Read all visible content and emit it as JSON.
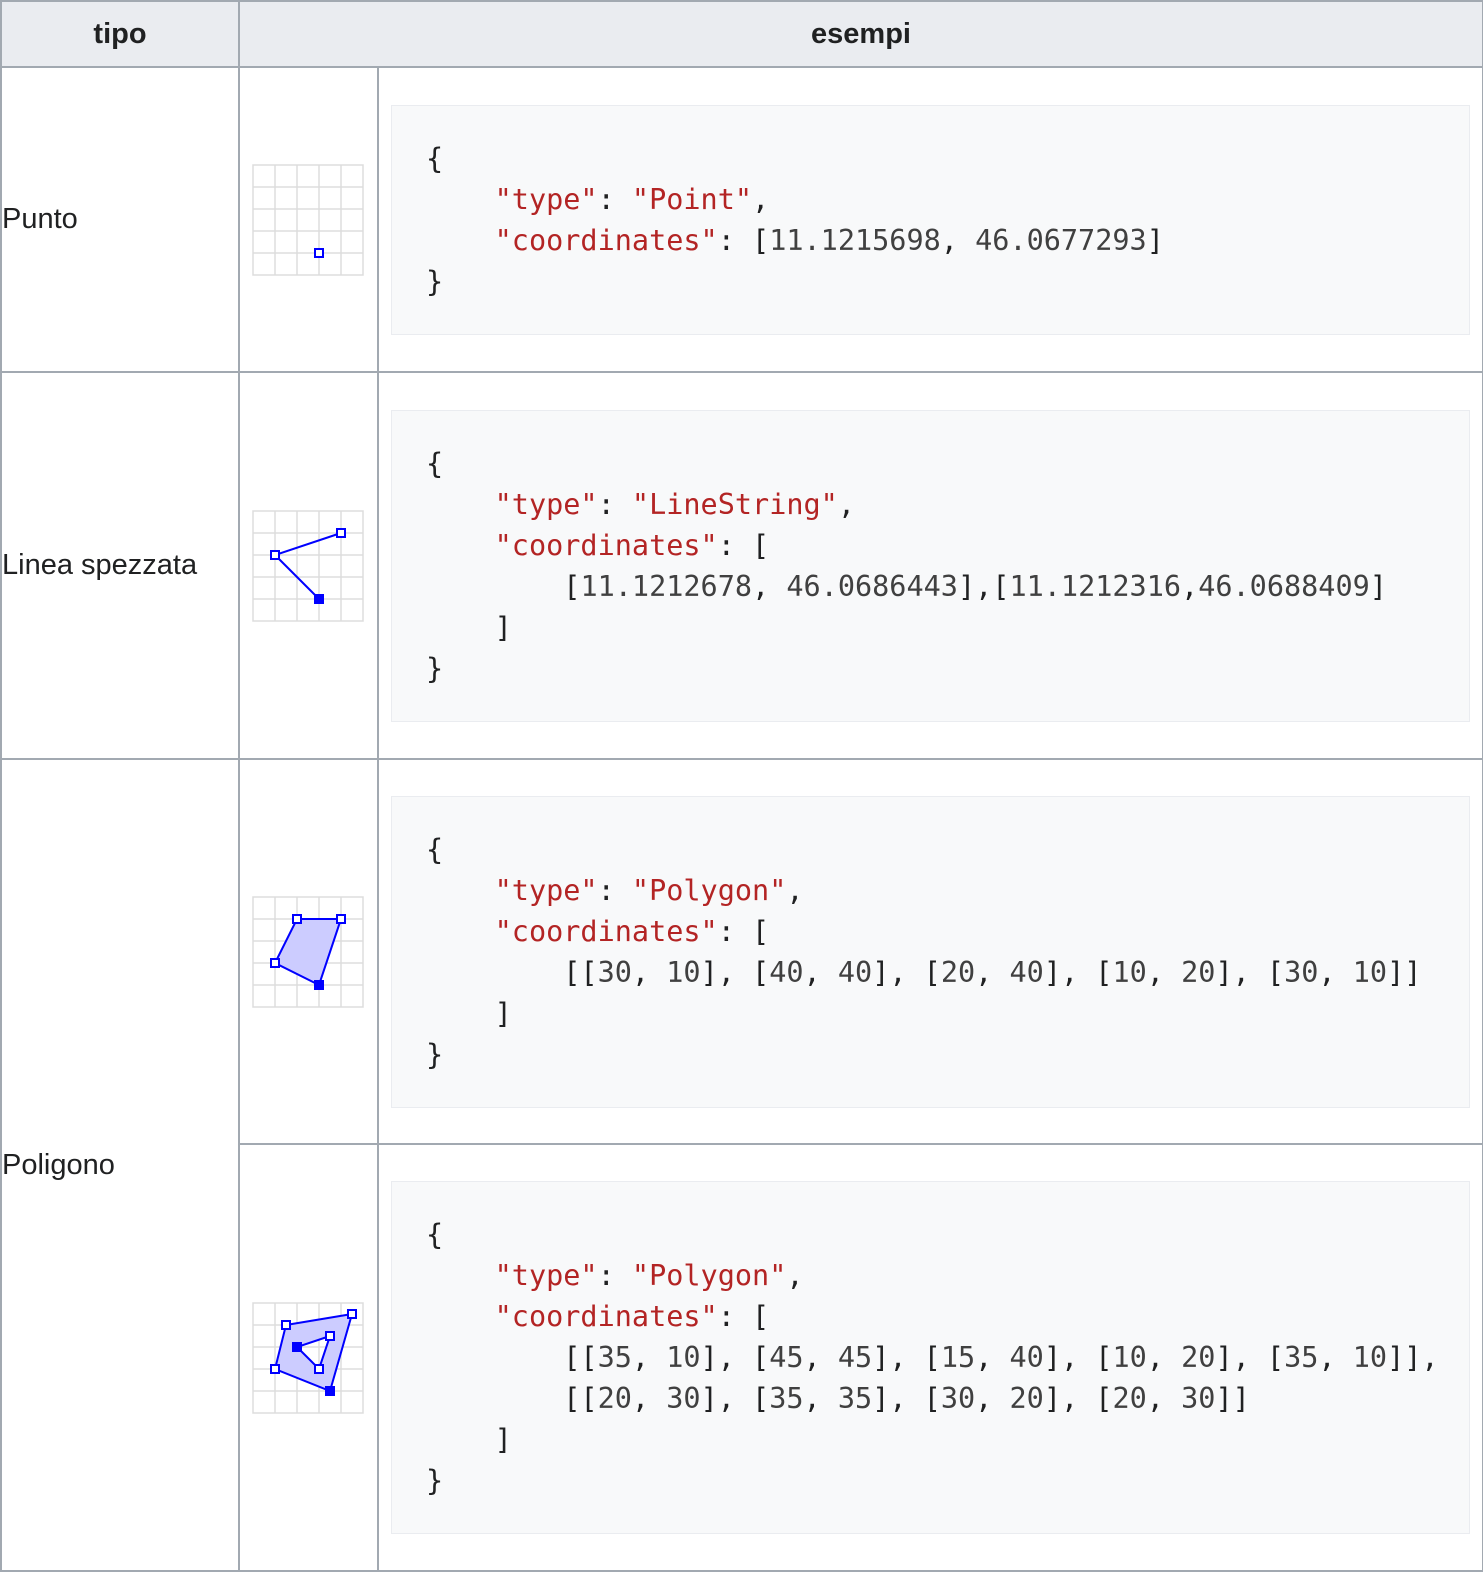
{
  "header": {
    "type_label": "tipo",
    "examples_label": "esempi"
  },
  "rows": [
    {
      "type": "Punto",
      "icon": "point-geometry-icon",
      "code": [
        [
          {
            "t": "{",
            "c": "punc"
          }
        ],
        [
          {
            "t": "    ",
            "c": "punc"
          },
          {
            "t": "\"type\"",
            "c": "key"
          },
          {
            "t": ": ",
            "c": "punc"
          },
          {
            "t": "\"Point\"",
            "c": "str"
          },
          {
            "t": ",",
            "c": "punc"
          }
        ],
        [
          {
            "t": "    ",
            "c": "punc"
          },
          {
            "t": "\"coordinates\"",
            "c": "key"
          },
          {
            "t": ": [",
            "c": "punc"
          },
          {
            "t": "11.1215698",
            "c": "num"
          },
          {
            "t": ", ",
            "c": "punc"
          },
          {
            "t": "46.0677293",
            "c": "num"
          },
          {
            "t": "]",
            "c": "punc"
          }
        ],
        [
          {
            "t": "}",
            "c": "punc"
          }
        ]
      ]
    },
    {
      "type": "Linea spezzata",
      "icon": "linestring-geometry-icon",
      "code": [
        [
          {
            "t": "{",
            "c": "punc"
          }
        ],
        [
          {
            "t": "    ",
            "c": "punc"
          },
          {
            "t": "\"type\"",
            "c": "key"
          },
          {
            "t": ": ",
            "c": "punc"
          },
          {
            "t": "\"LineString\"",
            "c": "str"
          },
          {
            "t": ",",
            "c": "punc"
          }
        ],
        [
          {
            "t": "    ",
            "c": "punc"
          },
          {
            "t": "\"coordinates\"",
            "c": "key"
          },
          {
            "t": ": [",
            "c": "punc"
          }
        ],
        [
          {
            "t": "        [",
            "c": "punc"
          },
          {
            "t": "11.1212678",
            "c": "num"
          },
          {
            "t": ", ",
            "c": "punc"
          },
          {
            "t": "46.0686443",
            "c": "num"
          },
          {
            "t": "],[",
            "c": "punc"
          },
          {
            "t": "11.1212316",
            "c": "num"
          },
          {
            "t": ",",
            "c": "punc"
          },
          {
            "t": "46.0688409",
            "c": "num"
          },
          {
            "t": "]",
            "c": "punc"
          }
        ],
        [
          {
            "t": "    ]",
            "c": "punc"
          }
        ],
        [
          {
            "t": "}",
            "c": "punc"
          }
        ]
      ]
    },
    {
      "type": "Poligono",
      "icon": "polygon-geometry-icon",
      "code": [
        [
          {
            "t": "{",
            "c": "punc"
          }
        ],
        [
          {
            "t": "    ",
            "c": "punc"
          },
          {
            "t": "\"type\"",
            "c": "key"
          },
          {
            "t": ": ",
            "c": "punc"
          },
          {
            "t": "\"Polygon\"",
            "c": "str"
          },
          {
            "t": ",",
            "c": "punc"
          }
        ],
        [
          {
            "t": "    ",
            "c": "punc"
          },
          {
            "t": "\"coordinates\"",
            "c": "key"
          },
          {
            "t": ": [",
            "c": "punc"
          }
        ],
        [
          {
            "t": "        [[",
            "c": "punc"
          },
          {
            "t": "30",
            "c": "num"
          },
          {
            "t": ", ",
            "c": "punc"
          },
          {
            "t": "10",
            "c": "num"
          },
          {
            "t": "], [",
            "c": "punc"
          },
          {
            "t": "40",
            "c": "num"
          },
          {
            "t": ", ",
            "c": "punc"
          },
          {
            "t": "40",
            "c": "num"
          },
          {
            "t": "], [",
            "c": "punc"
          },
          {
            "t": "20",
            "c": "num"
          },
          {
            "t": ", ",
            "c": "punc"
          },
          {
            "t": "40",
            "c": "num"
          },
          {
            "t": "], [",
            "c": "punc"
          },
          {
            "t": "10",
            "c": "num"
          },
          {
            "t": ", ",
            "c": "punc"
          },
          {
            "t": "20",
            "c": "num"
          },
          {
            "t": "], [",
            "c": "punc"
          },
          {
            "t": "30",
            "c": "num"
          },
          {
            "t": ", ",
            "c": "punc"
          },
          {
            "t": "10",
            "c": "num"
          },
          {
            "t": "]]",
            "c": "punc"
          }
        ],
        [
          {
            "t": "    ]",
            "c": "punc"
          }
        ],
        [
          {
            "t": "}",
            "c": "punc"
          }
        ]
      ]
    },
    {
      "type": "",
      "icon": "polygon-with-hole-geometry-icon",
      "code": [
        [
          {
            "t": "{",
            "c": "punc"
          }
        ],
        [
          {
            "t": "    ",
            "c": "punc"
          },
          {
            "t": "\"type\"",
            "c": "key"
          },
          {
            "t": ": ",
            "c": "punc"
          },
          {
            "t": "\"Polygon\"",
            "c": "str"
          },
          {
            "t": ",",
            "c": "punc"
          }
        ],
        [
          {
            "t": "    ",
            "c": "punc"
          },
          {
            "t": "\"coordinates\"",
            "c": "key"
          },
          {
            "t": ": [",
            "c": "punc"
          }
        ],
        [
          {
            "t": "        [[",
            "c": "punc"
          },
          {
            "t": "35",
            "c": "num"
          },
          {
            "t": ", ",
            "c": "punc"
          },
          {
            "t": "10",
            "c": "num"
          },
          {
            "t": "], [",
            "c": "punc"
          },
          {
            "t": "45",
            "c": "num"
          },
          {
            "t": ", ",
            "c": "punc"
          },
          {
            "t": "45",
            "c": "num"
          },
          {
            "t": "], [",
            "c": "punc"
          },
          {
            "t": "15",
            "c": "num"
          },
          {
            "t": ", ",
            "c": "punc"
          },
          {
            "t": "40",
            "c": "num"
          },
          {
            "t": "], [",
            "c": "punc"
          },
          {
            "t": "10",
            "c": "num"
          },
          {
            "t": ", ",
            "c": "punc"
          },
          {
            "t": "20",
            "c": "num"
          },
          {
            "t": "], [",
            "c": "punc"
          },
          {
            "t": "35",
            "c": "num"
          },
          {
            "t": ", ",
            "c": "punc"
          },
          {
            "t": "10",
            "c": "num"
          },
          {
            "t": "]],",
            "c": "punc"
          }
        ],
        [
          {
            "t": "        [[",
            "c": "punc"
          },
          {
            "t": "20",
            "c": "num"
          },
          {
            "t": ", ",
            "c": "punc"
          },
          {
            "t": "30",
            "c": "num"
          },
          {
            "t": "], [",
            "c": "punc"
          },
          {
            "t": "35",
            "c": "num"
          },
          {
            "t": ", ",
            "c": "punc"
          },
          {
            "t": "35",
            "c": "num"
          },
          {
            "t": "], [",
            "c": "punc"
          },
          {
            "t": "30",
            "c": "num"
          },
          {
            "t": ", ",
            "c": "punc"
          },
          {
            "t": "20",
            "c": "num"
          },
          {
            "t": "], [",
            "c": "punc"
          },
          {
            "t": "20",
            "c": "num"
          },
          {
            "t": ", ",
            "c": "punc"
          },
          {
            "t": "30",
            "c": "num"
          },
          {
            "t": "]]",
            "c": "punc"
          }
        ],
        [
          {
            "t": "    ]",
            "c": "punc"
          }
        ],
        [
          {
            "t": "}",
            "c": "punc"
          }
        ]
      ]
    }
  ],
  "colors": {
    "key": "#b32424",
    "number": "#404040",
    "geometry": "#0000ff",
    "fill": "#ccccff",
    "grid": "#dddddd"
  }
}
